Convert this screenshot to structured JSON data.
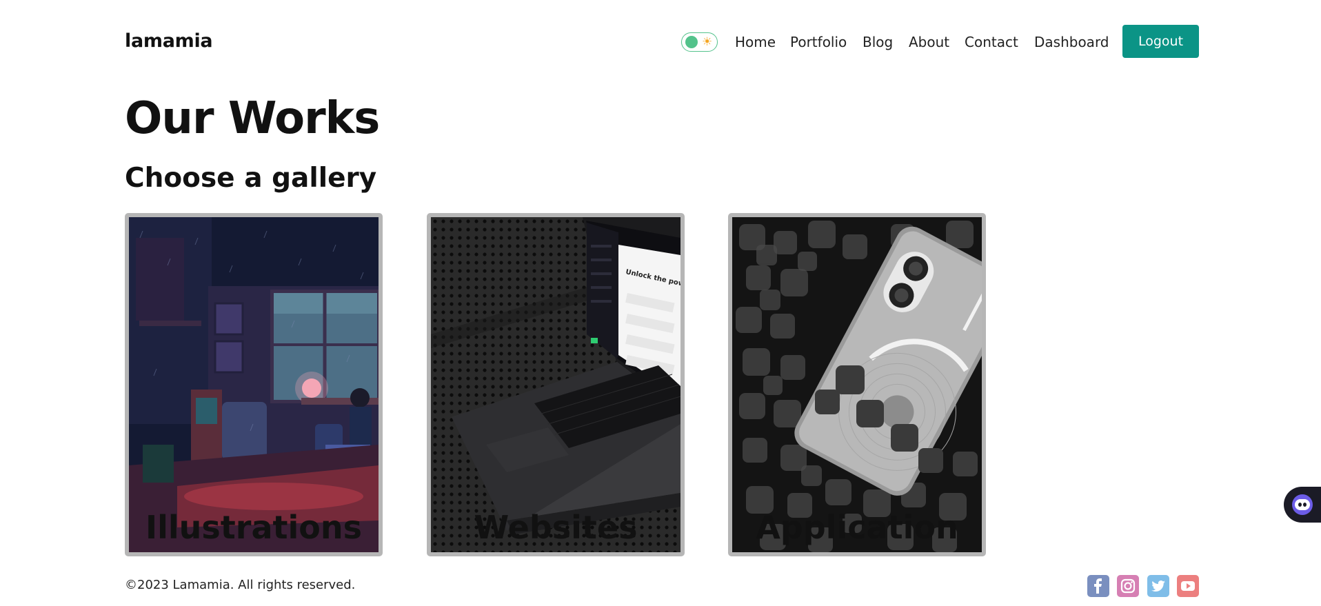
{
  "brand": {
    "name": "lamamia"
  },
  "theme_toggle": {
    "knob_color": "#53c28b",
    "icon": "sun-icon"
  },
  "nav": {
    "items": [
      "Home",
      "Portfolio",
      "Blog",
      "About",
      "Contact",
      "Dashboard"
    ],
    "logout_label": "Logout"
  },
  "colors": {
    "accent": "#0b9486",
    "card_border": "#b6b6b6"
  },
  "page": {
    "title": "Our Works",
    "subtitle": "Choose a gallery"
  },
  "galleries": [
    {
      "label": "Illustrations",
      "image": "pixel-art-room-at-night"
    },
    {
      "label": "Websites",
      "image": "laptop-on-perforated-metal"
    },
    {
      "label": "Application",
      "image": "phone-on-foam-cubes"
    }
  ],
  "footer": {
    "copyright": "©2023 Lamamia. All rights reserved.",
    "social": [
      "facebook-icon",
      "instagram-icon",
      "twitter-icon",
      "youtube-icon"
    ]
  },
  "chat_widget": {
    "icon": "chatbot-icon"
  }
}
